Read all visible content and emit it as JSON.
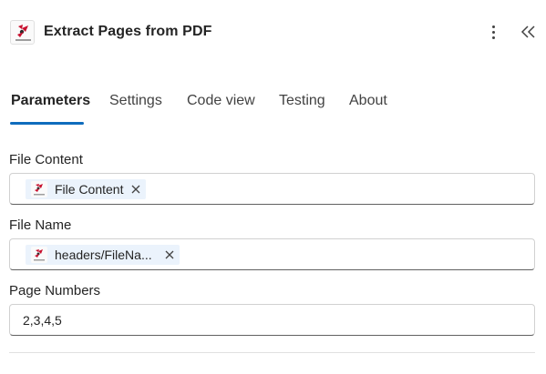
{
  "header": {
    "title": "Extract Pages from PDF",
    "logo_icon": "api4ai-logo",
    "more_icon": "more-vertical-icon",
    "collapse_icon": "double-chevron-left-icon"
  },
  "tabs": [
    {
      "label": "Parameters",
      "active": true
    },
    {
      "label": "Settings",
      "active": false
    },
    {
      "label": "Code view",
      "active": false
    },
    {
      "label": "Testing",
      "active": false
    },
    {
      "label": "About",
      "active": false
    }
  ],
  "fields": {
    "file_content": {
      "label": "File Content",
      "token": "File Content"
    },
    "file_name": {
      "label": "File Name",
      "token": "headers/FileNa..."
    },
    "page_numbers": {
      "label": "Page Numbers",
      "value": "2,3,4,5"
    }
  },
  "colors": {
    "accent": "#0f6cbd",
    "token_bg": "#ebf3fc",
    "logo_red": "#c8102e"
  }
}
